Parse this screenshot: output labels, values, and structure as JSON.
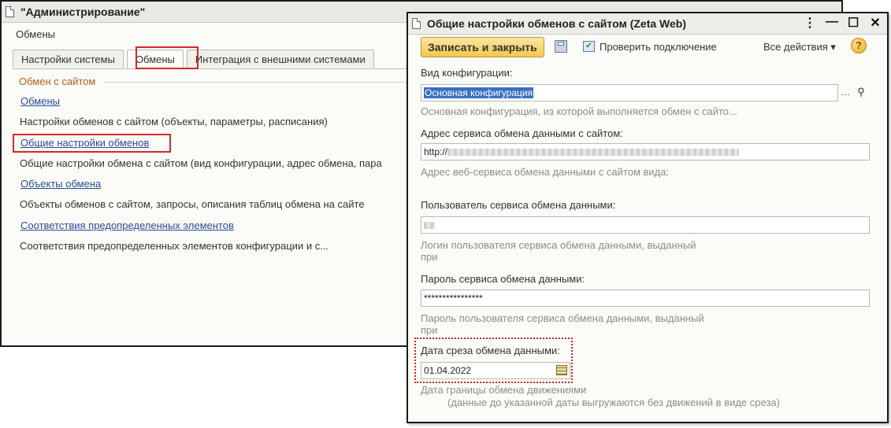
{
  "admin": {
    "title": "\"Администрирование\"",
    "subtitle": "Обмены",
    "tabs": [
      {
        "label": "Настройки системы"
      },
      {
        "label": "Обмены"
      },
      {
        "label": "Интеграция с внешними системами"
      }
    ],
    "group_label": "Обмен с сайтом",
    "items": [
      {
        "link": "Обмены",
        "desc": "Настройки обменов с сайтом (объекты, параметры, расписания)"
      },
      {
        "link": "Общие настройки обменов",
        "desc": "Общие настройки обмена с сайтом (вид конфигурации, адрес обмена, пара"
      },
      {
        "link": "Объекты обмена",
        "desc": "Объекты обменов с сайтом, запросы, описания таблиц обмена на сайте"
      },
      {
        "link": "Соответствия предопределенных элементов",
        "desc": "Соответствия предопределенных элементов конфигурации и с..."
      }
    ]
  },
  "settings": {
    "title": "Общие настройки обменов с сайтом (Zeta Web)",
    "window_buttons": [
      "⋮",
      "—",
      "☐",
      "✕"
    ],
    "toolbar": {
      "save_close": "Записать и закрыть",
      "check_connection": "Проверить подключение",
      "all_actions": "Все действия ▾",
      "help": "?"
    },
    "config": {
      "label": "Вид конфигурации:",
      "value": "Основная конфигурация",
      "hint": "Основная конфигурация, из которой выполняется обмен с сайто..."
    },
    "address": {
      "label": "Адрес сервиса обмена данными с сайтом:",
      "value": "http://",
      "hint": "Адрес веб-сервиса обмена данными с сайтом вида:"
    },
    "user": {
      "label": "Пользователь сервиса обмена данными:",
      "hint": "Логин пользователя сервиса обмена данными, выданный\nпри"
    },
    "password": {
      "label": "Пароль сервиса обмена данными:",
      "value": "****************",
      "hint": "Пароль пользователя сервиса обмена данными, выданный\nпри"
    },
    "date": {
      "label": "Дата среза обмена данными:",
      "value": "01.04.2022",
      "hint1": "Дата границы обмена движениями",
      "hint2": "(данные до указанной даты выгружаются без движений в виде среза)"
    }
  },
  "colors": {
    "link": "#2b4a9c",
    "highlight_red": "#d42a2a",
    "primary_button": "#f2c84b",
    "selection": "#3a6fc4"
  }
}
